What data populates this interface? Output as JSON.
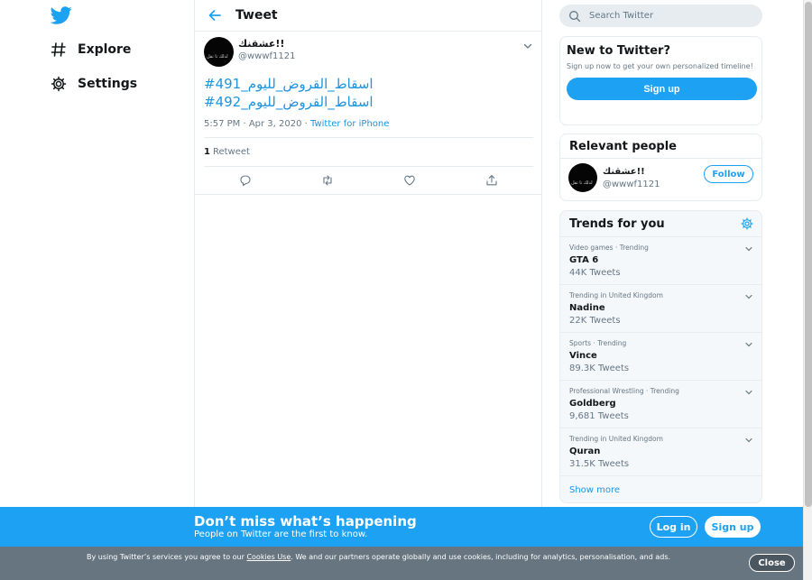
{
  "nav": {
    "logo_icon": "twitter-bird-icon",
    "items": [
      {
        "label": "Explore",
        "icon": "hash-icon"
      },
      {
        "label": "Settings",
        "icon": "gear-icon"
      }
    ]
  },
  "header": {
    "title": "Tweet",
    "back_icon": "arrow-left-icon"
  },
  "tweet": {
    "author_name": "عشقنك!!",
    "author_handle": "@wwwf1121",
    "avatar_text": "لذلك تا تقل",
    "hashtags": [
      "#اسقاط_القروض_لليوم_491",
      "#اسقاط_القروض_لليوم_492"
    ],
    "timestamp": "5:57 PM · Apr 3, 2020 · ",
    "source": "Twitter for iPhone",
    "retweet_count": "1",
    "retweet_label": "Retweet"
  },
  "search": {
    "placeholder": "Search Twitter"
  },
  "new_to_twitter": {
    "title": "New to Twitter?",
    "description": "Sign up now to get your own personalized timeline!",
    "signup_label": "Sign up"
  },
  "relevant_people": {
    "title": "Relevant people",
    "name": "عشقنك!!",
    "handle": "@wwwf1121",
    "follow_label": "Follow"
  },
  "trends": {
    "title": "Trends for you",
    "items": [
      {
        "context": "Video games · Trending",
        "name": "GTA 6",
        "count": "44K Tweets"
      },
      {
        "context": "Trending in United Kingdom",
        "name": "Nadine",
        "count": "22K Tweets"
      },
      {
        "context": "Sports · Trending",
        "name": "Vince",
        "count": "89.3K Tweets"
      },
      {
        "context": "Professional Wrestling · Trending",
        "name": "Goldberg",
        "count": "9,681 Tweets"
      },
      {
        "context": "Trending in United Kingdom",
        "name": "Quran",
        "count": "31.5K Tweets"
      }
    ],
    "show_more": "Show more"
  },
  "banner": {
    "headline": "Don’t miss what’s happening",
    "subline": "People on Twitter are the first to know.",
    "login_label": "Log in",
    "signup_label": "Sign up"
  },
  "cookie": {
    "text_before": "By using Twitter’s services you agree to our ",
    "link": "Cookies Use",
    "text_after": ". We and our partners operate globally and use cookies, including for analytics, personalisation, and ads.",
    "close_label": "Close"
  },
  "colors": {
    "accent": "#1da1f2",
    "link": "#1b95e0",
    "banner": "#1da1f2",
    "cookie_bar": "#66757f"
  }
}
